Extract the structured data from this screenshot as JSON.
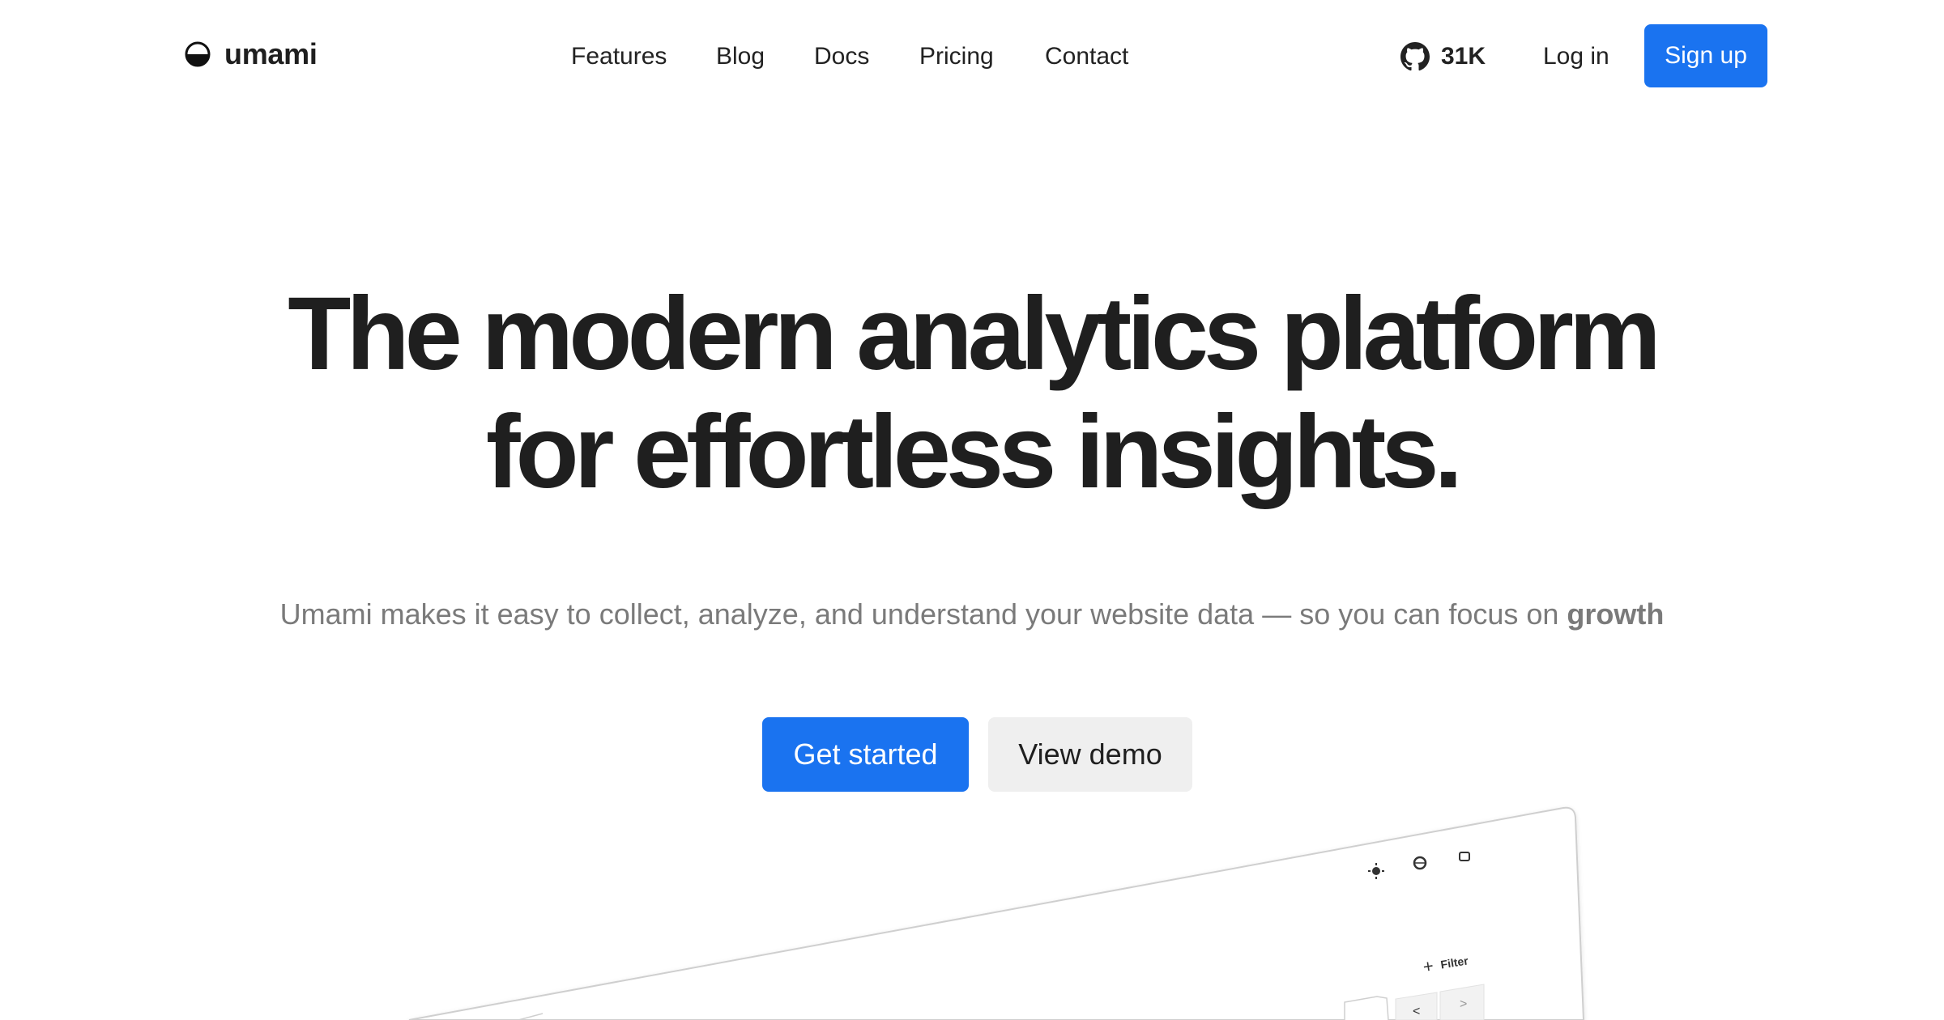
{
  "brand": {
    "name": "umami",
    "icon": "umami-logo-icon"
  },
  "nav": {
    "items": [
      {
        "label": "Features"
      },
      {
        "label": "Blog"
      },
      {
        "label": "Docs"
      },
      {
        "label": "Pricing"
      },
      {
        "label": "Contact"
      }
    ],
    "github": {
      "icon": "github-icon",
      "count": "31K"
    },
    "login_label": "Log in",
    "signup_label": "Sign up"
  },
  "hero": {
    "title_line1": "The modern analytics platform",
    "title_line2": "for effortless insights.",
    "subtitle": "Umami makes it easy to collect, analyze, and understand your website data — so you can focus on ",
    "subtitle_emphasis": "growth",
    "primary_cta": "Get started",
    "secondary_cta": "View demo"
  },
  "preview": {
    "filter_label": "Filter",
    "prev_label": "<",
    "next_label": ">",
    "icons": [
      "sun-icon",
      "globe-icon",
      "settings-icon"
    ]
  },
  "colors": {
    "accent": "#1a73f0",
    "text": "#1f1f1f",
    "muted": "#7a7a7a",
    "secondary_button_bg": "#efefef"
  }
}
